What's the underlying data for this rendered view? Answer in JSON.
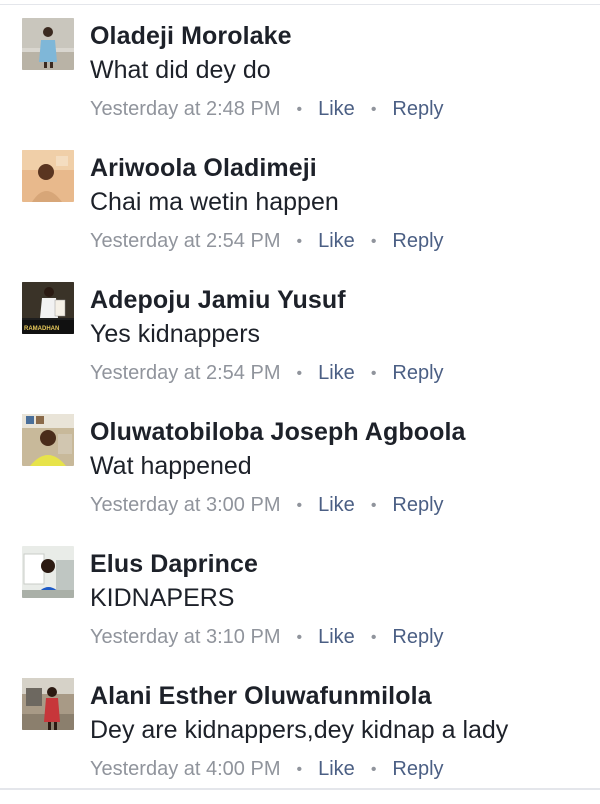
{
  "comments": [
    {
      "author": "Oladeji Morolake",
      "text": "What did dey do",
      "time": "Yesterday at 2:48 PM",
      "like_label": "Like",
      "reply_label": "Reply"
    },
    {
      "author": "Ariwoola Oladimeji",
      "text": "Chai ma wetin happen",
      "time": "Yesterday at 2:54 PM",
      "like_label": "Like",
      "reply_label": "Reply"
    },
    {
      "author": "Adepoju Jamiu Yusuf",
      "text": "Yes kidnappers",
      "time": "Yesterday at 2:54 PM",
      "like_label": "Like",
      "reply_label": "Reply",
      "avatar_caption": "RAMADHAN"
    },
    {
      "author": "Oluwatobiloba Joseph Agboola",
      "text": "Wat happened",
      "time": "Yesterday at 3:00 PM",
      "like_label": "Like",
      "reply_label": "Reply"
    },
    {
      "author": "Elus Daprince",
      "text": "KIDNAPERS",
      "time": "Yesterday at 3:10 PM",
      "like_label": "Like",
      "reply_label": "Reply"
    },
    {
      "author": "Alani Esther Oluwafunmilola",
      "text": "Dey are kidnappers,dey kidnap a lady",
      "time": "Yesterday at 4:00 PM",
      "like_label": "Like",
      "reply_label": "Reply"
    }
  ],
  "separator": "•",
  "colors": {
    "name": "#1d2129",
    "meta": "#90949c",
    "action": "#4b5f84",
    "divider": "#e4e6eb"
  }
}
